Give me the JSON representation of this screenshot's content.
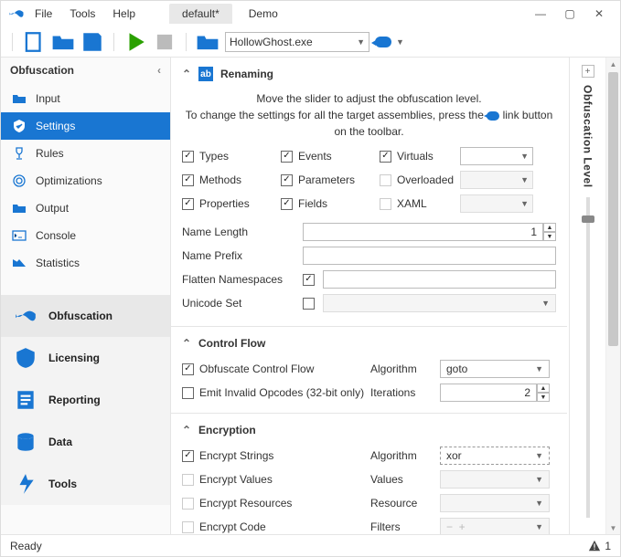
{
  "menu": {
    "file": "File",
    "tools": "Tools",
    "help": "Help"
  },
  "tabs": {
    "active": "default*",
    "inactive": "Demo"
  },
  "windowControls": {
    "min": "—",
    "max": "▢",
    "close": "✕"
  },
  "toolbar": {
    "assembly": "HollowGhost.exe"
  },
  "sidebar": {
    "title": "Obfuscation",
    "nav": [
      {
        "label": "Input"
      },
      {
        "label": "Settings"
      },
      {
        "label": "Rules"
      },
      {
        "label": "Optimizations"
      },
      {
        "label": "Output"
      },
      {
        "label": "Console"
      },
      {
        "label": "Statistics"
      }
    ],
    "features": [
      {
        "label": "Obfuscation"
      },
      {
        "label": "Licensing"
      },
      {
        "label": "Reporting"
      },
      {
        "label": "Data"
      },
      {
        "label": "Tools"
      }
    ]
  },
  "renaming": {
    "title": "Renaming",
    "hint1": "Move the slider to adjust the obfuscation level.",
    "hint2a": "To change the settings for all the target assemblies, press the ",
    "hint2b": " link button on the toolbar.",
    "checks": {
      "types": "Types",
      "methods": "Methods",
      "properties": "Properties",
      "events": "Events",
      "parameters": "Parameters",
      "fields": "Fields",
      "virtuals": "Virtuals",
      "overloaded": "Overloaded",
      "xaml": "XAML"
    },
    "fields": {
      "nameLength": "Name Length",
      "namePrefix": "Name Prefix",
      "flatten": "Flatten Namespaces",
      "unicode": "Unicode Set"
    },
    "values": {
      "nameLength": "1"
    }
  },
  "controlflow": {
    "title": "Control Flow",
    "obf": "Obfuscate Control Flow",
    "emit": "Emit Invalid Opcodes (32-bit only)",
    "algorithm_lbl": "Algorithm",
    "iterations_lbl": "Iterations",
    "algorithm": "goto",
    "iterations": "2"
  },
  "encryption": {
    "title": "Encryption",
    "strings": "Encrypt Strings",
    "values_ck": "Encrypt Values",
    "resources": "Encrypt Resources",
    "code": "Encrypt Code",
    "algorithm_lbl": "Algorithm",
    "values_lbl": "Values",
    "resource_lbl": "Resource",
    "filters_lbl": "Filters",
    "algorithm": "xor"
  },
  "sliderLabel": "Obfuscation Level",
  "status": {
    "ready": "Ready",
    "warnCount": "1"
  }
}
